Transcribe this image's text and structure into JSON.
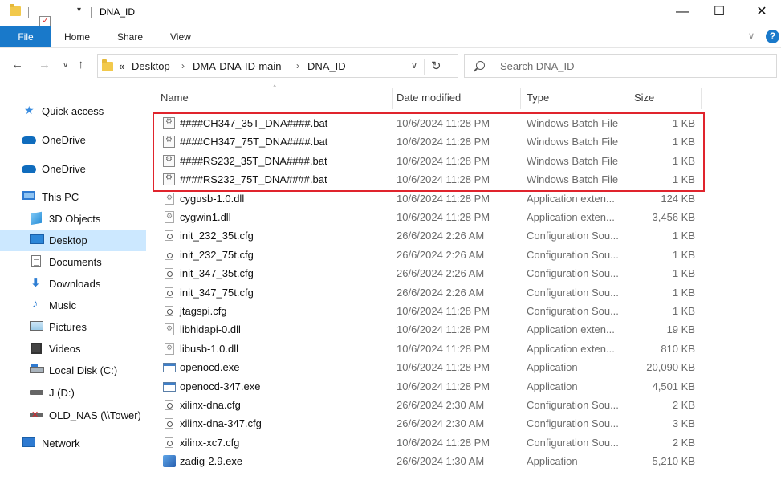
{
  "window": {
    "title": "DNA_ID",
    "minimize": "—",
    "maximize": "☐",
    "close": "✕"
  },
  "ribbon": {
    "tabs": [
      "File",
      "Home",
      "Share",
      "View"
    ],
    "help": "?"
  },
  "address": {
    "overflow": "«",
    "crumbs": [
      "Desktop",
      "DMA-DNA-ID-main",
      "DNA_ID"
    ],
    "separator": "›"
  },
  "search": {
    "placeholder": "Search DNA_ID"
  },
  "nav": {
    "items": [
      {
        "label": "Quick access",
        "icon": "quick-access-star-icon"
      },
      {
        "label": "OneDrive",
        "icon": "onedrive-cloud-icon"
      },
      {
        "label": "OneDrive",
        "icon": "onedrive-cloud-icon"
      },
      {
        "label": "This PC",
        "icon": "this-pc-icon"
      },
      {
        "label": "3D Objects",
        "icon": "3d-objects-icon"
      },
      {
        "label": "Desktop",
        "icon": "desktop-icon",
        "selected": true
      },
      {
        "label": "Documents",
        "icon": "documents-icon"
      },
      {
        "label": "Downloads",
        "icon": "downloads-icon"
      },
      {
        "label": "Music",
        "icon": "music-icon"
      },
      {
        "label": "Pictures",
        "icon": "pictures-icon"
      },
      {
        "label": "Videos",
        "icon": "videos-icon"
      },
      {
        "label": "Local Disk (C:)",
        "icon": "local-disk-icon"
      },
      {
        "label": "J (D:)",
        "icon": "drive-icon"
      },
      {
        "label": "OLD_NAS (\\\\Tower)",
        "icon": "disconnected-network-drive-icon"
      },
      {
        "label": "Network",
        "icon": "network-icon"
      }
    ]
  },
  "columns": {
    "name": "Name",
    "date": "Date modified",
    "type": "Type",
    "size": "Size"
  },
  "files": [
    {
      "name": "####CH347_35T_DNA####.bat",
      "date": "10/6/2024 11:28 PM",
      "type": "Windows Batch File",
      "size": "1 KB",
      "kind": "bat"
    },
    {
      "name": "####CH347_75T_DNA####.bat",
      "date": "10/6/2024 11:28 PM",
      "type": "Windows Batch File",
      "size": "1 KB",
      "kind": "bat"
    },
    {
      "name": "####RS232_35T_DNA####.bat",
      "date": "10/6/2024 11:28 PM",
      "type": "Windows Batch File",
      "size": "1 KB",
      "kind": "bat"
    },
    {
      "name": "####RS232_75T_DNA####.bat",
      "date": "10/6/2024 11:28 PM",
      "type": "Windows Batch File",
      "size": "1 KB",
      "kind": "bat"
    },
    {
      "name": "cygusb-1.0.dll",
      "date": "10/6/2024 11:28 PM",
      "type": "Application exten...",
      "size": "124 KB",
      "kind": "dll"
    },
    {
      "name": "cygwin1.dll",
      "date": "10/6/2024 11:28 PM",
      "type": "Application exten...",
      "size": "3,456 KB",
      "kind": "dll"
    },
    {
      "name": "init_232_35t.cfg",
      "date": "26/6/2024 2:26 AM",
      "type": "Configuration Sou...",
      "size": "1 KB",
      "kind": "cfg"
    },
    {
      "name": "init_232_75t.cfg",
      "date": "26/6/2024 2:26 AM",
      "type": "Configuration Sou...",
      "size": "1 KB",
      "kind": "cfg"
    },
    {
      "name": "init_347_35t.cfg",
      "date": "26/6/2024 2:26 AM",
      "type": "Configuration Sou...",
      "size": "1 KB",
      "kind": "cfg"
    },
    {
      "name": "init_347_75t.cfg",
      "date": "26/6/2024 2:26 AM",
      "type": "Configuration Sou...",
      "size": "1 KB",
      "kind": "cfg"
    },
    {
      "name": "jtagspi.cfg",
      "date": "10/6/2024 11:28 PM",
      "type": "Configuration Sou...",
      "size": "1 KB",
      "kind": "cfg"
    },
    {
      "name": "libhidapi-0.dll",
      "date": "10/6/2024 11:28 PM",
      "type": "Application exten...",
      "size": "19 KB",
      "kind": "dll"
    },
    {
      "name": "libusb-1.0.dll",
      "date": "10/6/2024 11:28 PM",
      "type": "Application exten...",
      "size": "810 KB",
      "kind": "dll"
    },
    {
      "name": "openocd.exe",
      "date": "10/6/2024 11:28 PM",
      "type": "Application",
      "size": "20,090 KB",
      "kind": "exe"
    },
    {
      "name": "openocd-347.exe",
      "date": "10/6/2024 11:28 PM",
      "type": "Application",
      "size": "4,501 KB",
      "kind": "exe"
    },
    {
      "name": "xilinx-dna.cfg",
      "date": "26/6/2024 2:30 AM",
      "type": "Configuration Sou...",
      "size": "2 KB",
      "kind": "cfg"
    },
    {
      "name": "xilinx-dna-347.cfg",
      "date": "26/6/2024 2:30 AM",
      "type": "Configuration Sou...",
      "size": "3 KB",
      "kind": "cfg"
    },
    {
      "name": "xilinx-xc7.cfg",
      "date": "10/6/2024 11:28 PM",
      "type": "Configuration Sou...",
      "size": "2 KB",
      "kind": "cfg"
    },
    {
      "name": "zadig-2.9.exe",
      "date": "26/6/2024 1:30 AM",
      "type": "Application",
      "size": "5,210 KB",
      "kind": "zadig"
    }
  ],
  "colors": {
    "accent": "#1979ca",
    "selection": "#cce8ff",
    "highlight_box": "#e0242d"
  }
}
